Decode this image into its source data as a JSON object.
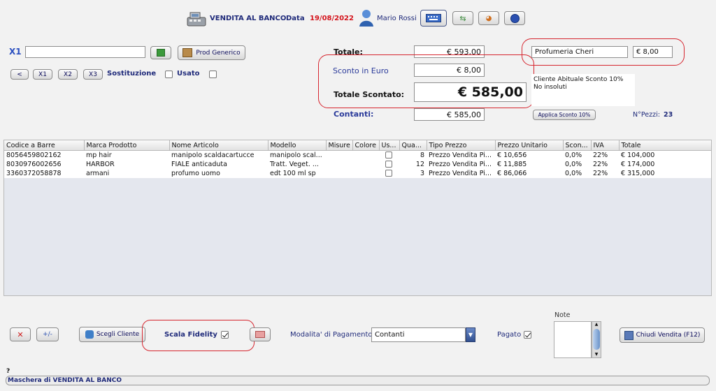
{
  "header": {
    "title": "VENDITA AL BANCO",
    "date_label": "Data",
    "date_value": "19/08/2022",
    "user": "Mario Rossi"
  },
  "search": {
    "x1_label": "X1",
    "x1_value": "",
    "prod_generico_label": "Prod Generico",
    "buttons": [
      "<",
      "X1",
      "X2",
      "X3"
    ],
    "sostituzione_label": "Sostituzione",
    "usato_label": "Usato"
  },
  "totals": {
    "totale_label": "Totale:",
    "totale_value": "€ 593,00",
    "sconto_label": "Sconto in Euro",
    "sconto_value": "€ 8,00",
    "scontato_label": "Totale Scontato:",
    "scontato_value": "€ 585,00",
    "contanti_label": "Contanti:",
    "contanti_value": "€ 585,00"
  },
  "customer": {
    "name": "Profumeria Cheri",
    "discount_value": "€ 8,00",
    "note_line1": "Cliente Abituale Sconto 10%",
    "note_line2": "No insoluti",
    "applica_sconto_label": "Applica Sconto  10%",
    "npezzi_label": "N°Pezzi:",
    "npezzi_value": "23"
  },
  "table": {
    "columns": [
      "Codice a Barre",
      "Marca Prodotto",
      "Nome Articolo",
      "Modello",
      "Misure",
      "Colore",
      "Us...",
      "Qua...",
      "Tipo Prezzo",
      "Prezzo Unitario",
      "Scon...",
      "IVA",
      "Totale"
    ],
    "rows": [
      [
        "8056459802162",
        "mp hair",
        "manipolo scaldacartucce",
        "manipolo scal...",
        "",
        "",
        "",
        "8",
        "Prezzo Vendita Pi...",
        "€ 10,656",
        "0,0%",
        "22%",
        "€ 104,000"
      ],
      [
        "8030976002656",
        "HARBOR",
        "FIALE anticaduta",
        "Tratt. Veget. ...",
        "",
        "",
        "",
        "12",
        "Prezzo Vendita Pi...",
        "€ 11,885",
        "0,0%",
        "22%",
        "€ 174,000"
      ],
      [
        "3360372058878",
        "armani",
        "profumo uomo",
        "edt 100 ml sp",
        "",
        "",
        "",
        "3",
        "Prezzo Vendita Pi...",
        "€ 86,066",
        "0,0%",
        "22%",
        "€ 315,000"
      ]
    ]
  },
  "footer": {
    "scegli_cliente_label": "Scegli Cliente",
    "scala_fidelity_label": "Scala Fidelity",
    "modalita_label": "Modalita' di Pagamento",
    "modalita_value": "Contanti",
    "pagato_label": "Pagato",
    "note_label": "Note",
    "chiudi_label": "Chiudi Vendita (F12)",
    "question": "?",
    "status": "Maschera di VENDITA AL BANCO"
  },
  "colors": {
    "accent_red": "#d6262f",
    "navy": "#1f2a7a",
    "date_red": "#d4141c"
  }
}
